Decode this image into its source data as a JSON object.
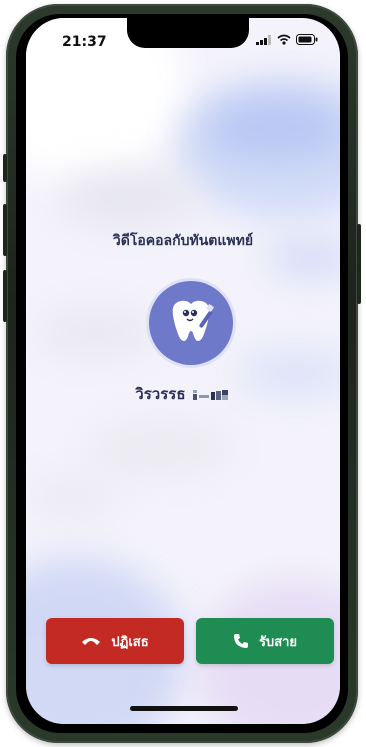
{
  "status_bar": {
    "time": "21:37",
    "icons": [
      "signal-icon",
      "wifi-icon",
      "battery-icon"
    ]
  },
  "call": {
    "title": "วิดีโอคอลกับทันตแพทย์",
    "caller_name": "วิรวรรธ",
    "avatar_icon": "tooth-mascot-icon"
  },
  "actions": {
    "decline_label": "ปฏิเสธ",
    "decline_icon": "hang-up-icon",
    "accept_label": "รับสาย",
    "accept_icon": "phone-icon"
  },
  "colors": {
    "decline": "#c42a24",
    "accept": "#1f8c53",
    "text": "#2b3256",
    "avatar": "#6f79c9"
  }
}
